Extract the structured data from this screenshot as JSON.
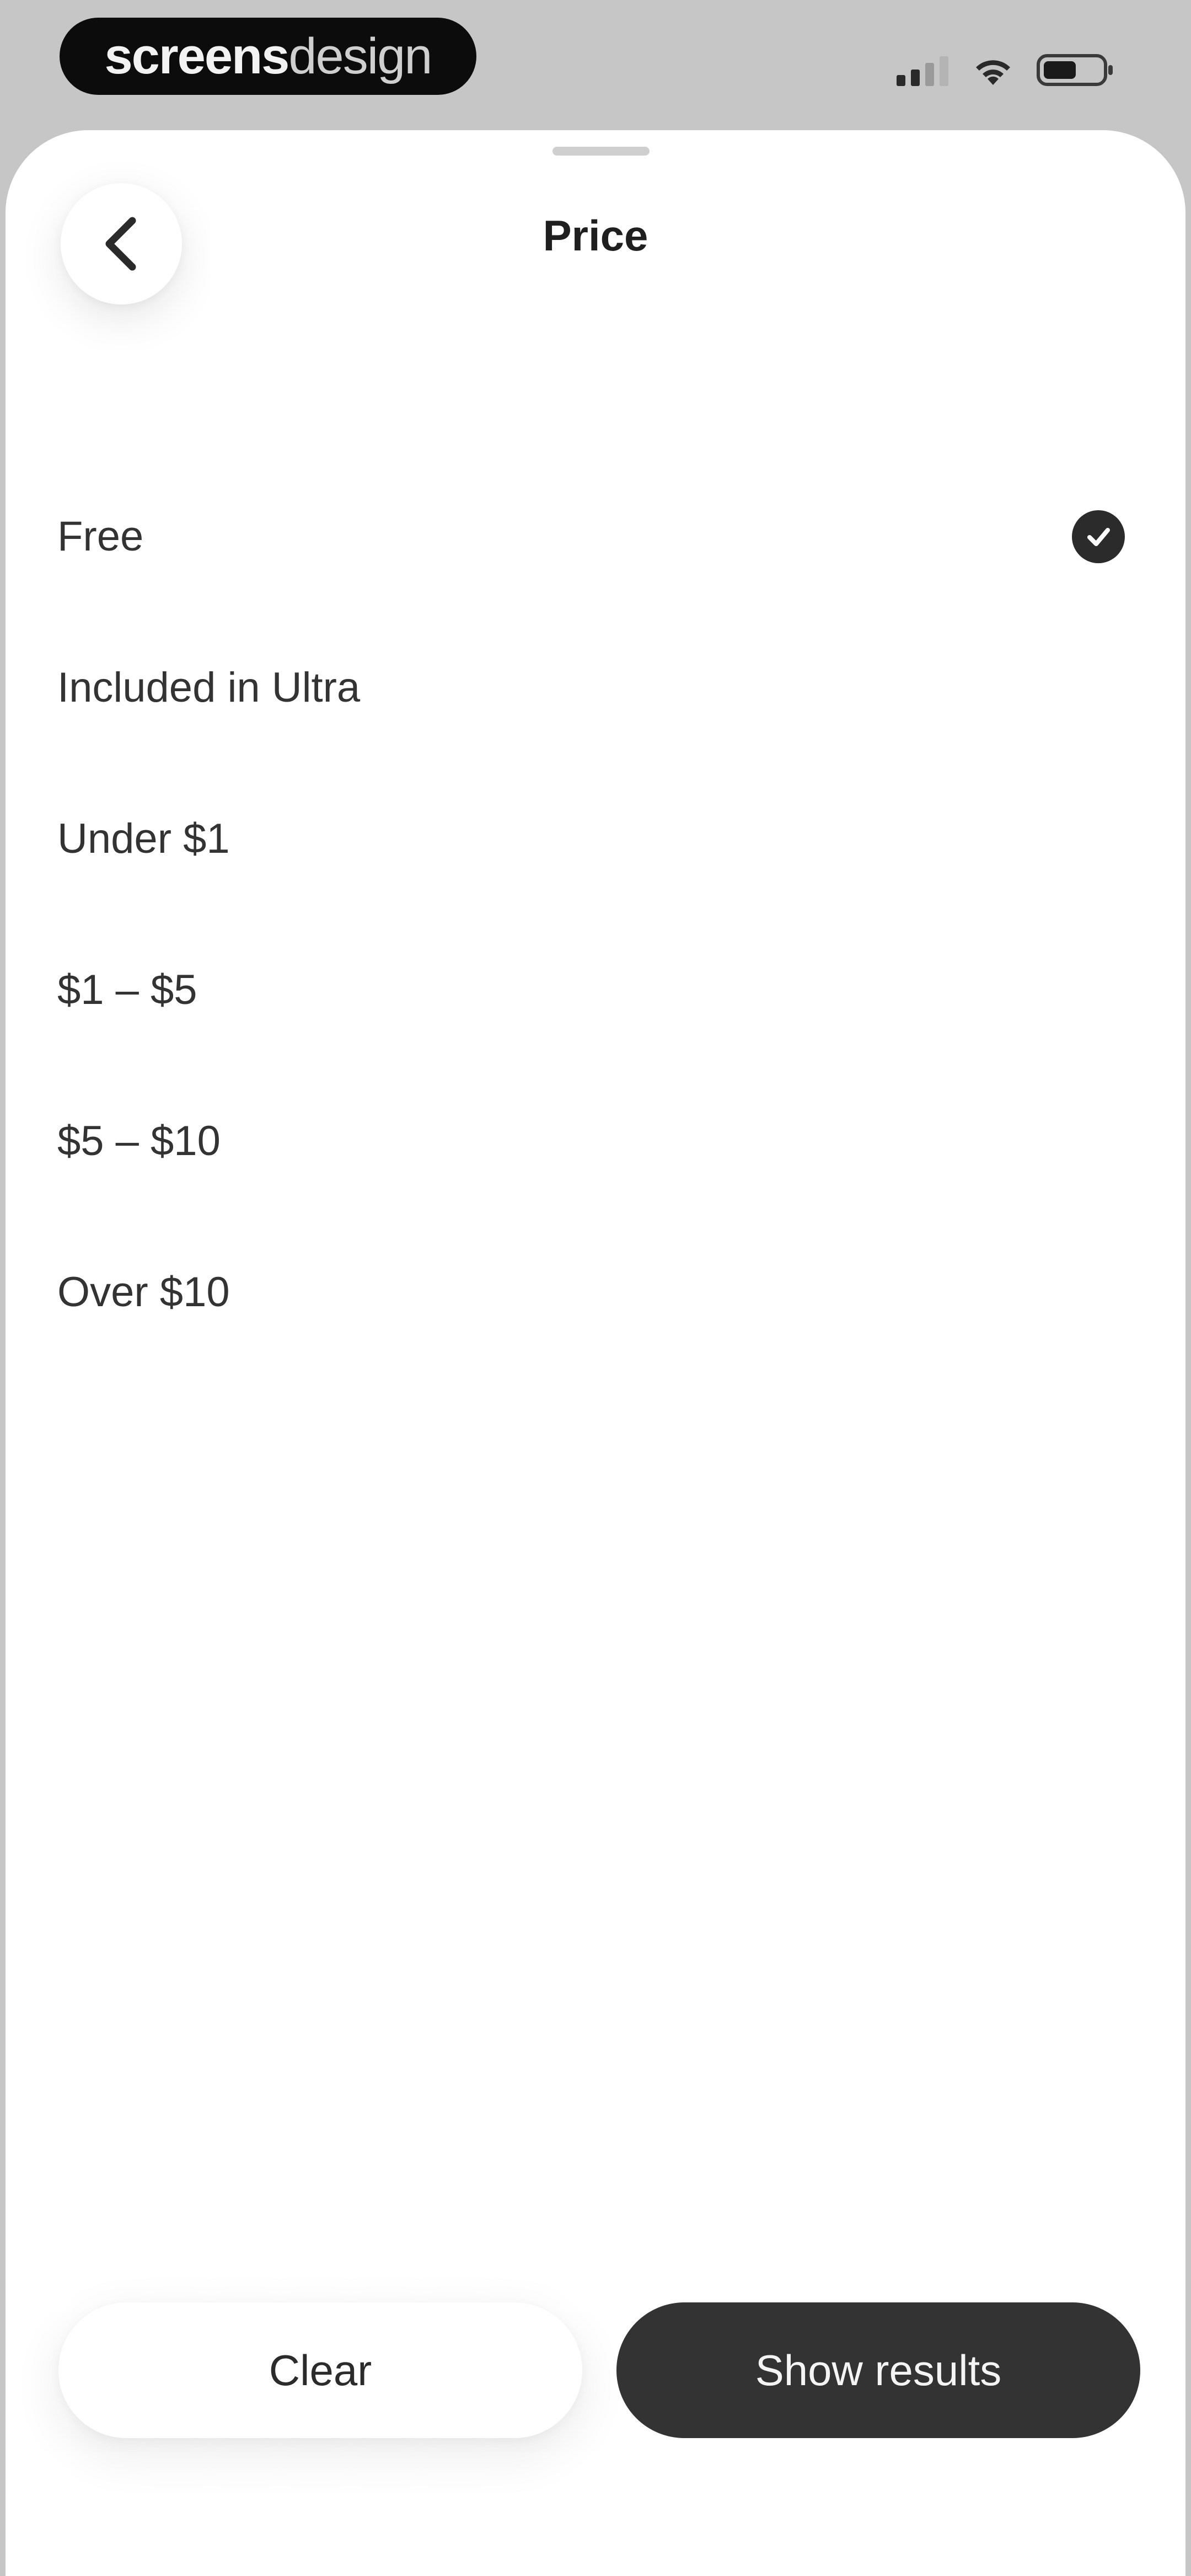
{
  "status_bar": {
    "brand_bold": "screens",
    "brand_light": "design",
    "icons": [
      "signal-icon",
      "wifi-icon",
      "battery-icon"
    ]
  },
  "sheet": {
    "title": "Price",
    "back_icon": "chevron-left-icon",
    "options": [
      {
        "label": "Free",
        "selected": true
      },
      {
        "label": "Included in Ultra",
        "selected": false
      },
      {
        "label": "Under $1",
        "selected": false
      },
      {
        "label": "$1 – $5",
        "selected": false
      },
      {
        "label": "$5 – $10",
        "selected": false
      },
      {
        "label": "Over $10",
        "selected": false
      }
    ]
  },
  "footer": {
    "clear_label": "Clear",
    "results_label": "Show results"
  },
  "colors": {
    "background": "#c6c6c6",
    "sheet": "#ffffff",
    "primary_button": "#333333",
    "text": "#333333"
  }
}
